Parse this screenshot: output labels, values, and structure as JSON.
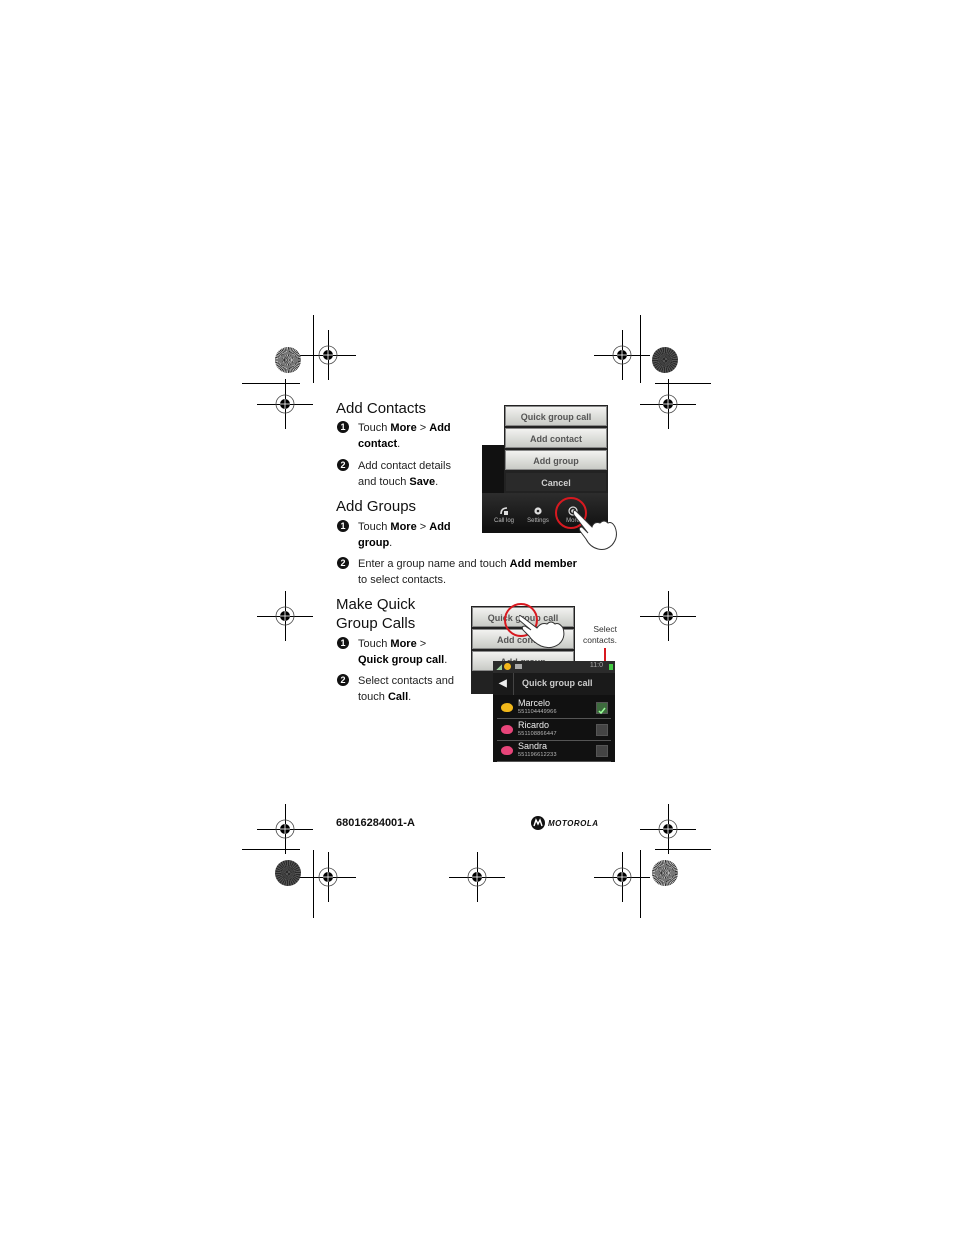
{
  "sections": [
    {
      "title": "Add Contacts",
      "steps": [
        {
          "num": "1",
          "parts": [
            {
              "t": "Touch "
            },
            {
              "t": "More",
              "b": true
            },
            {
              "t": " > "
            },
            {
              "t": "Add contact",
              "b": true
            },
            {
              "t": "."
            }
          ]
        },
        {
          "num": "2",
          "parts": [
            {
              "t": "Add contact details and touch "
            },
            {
              "t": "Save",
              "b": true
            },
            {
              "t": "."
            }
          ]
        }
      ]
    },
    {
      "title": "Add Groups",
      "steps": [
        {
          "num": "1",
          "parts": [
            {
              "t": "Touch "
            },
            {
              "t": "More",
              "b": true
            },
            {
              "t": " > "
            },
            {
              "t": "Add group",
              "b": true
            },
            {
              "t": "."
            }
          ]
        },
        {
          "num": "2",
          "parts": [
            {
              "t": "Enter a group name and touch "
            },
            {
              "t": "Add member",
              "b": true
            },
            {
              "t": " to select contacts."
            }
          ]
        }
      ]
    },
    {
      "title": "Make Quick Group Calls",
      "steps": [
        {
          "num": "1",
          "parts": [
            {
              "t": "Touch "
            },
            {
              "t": "More",
              "b": true
            },
            {
              "t": " > "
            },
            {
              "t": "Quick group call",
              "b": true
            },
            {
              "t": "."
            }
          ]
        },
        {
          "num": "2",
          "parts": [
            {
              "t": "Select contacts and touch "
            },
            {
              "t": "Call",
              "b": true
            },
            {
              "t": "."
            }
          ]
        }
      ]
    }
  ],
  "screen1": {
    "menu": [
      "Quick group call",
      "Add contact",
      "Add group",
      "Cancel"
    ],
    "dock": [
      {
        "label": "Call log",
        "icon": "call-log-icon"
      },
      {
        "label": "Settings",
        "icon": "settings-gear-icon"
      },
      {
        "label": "More",
        "icon": "more-icon"
      }
    ]
  },
  "screen2": {
    "menu": [
      "Quick group call",
      "Add contact",
      "Add group"
    ],
    "callout": "Select contacts.",
    "status_time": "11:0",
    "header_title": "Quick group call",
    "contacts": [
      {
        "name": "Marcelo",
        "number": "551104449966",
        "checked": true,
        "color": "#f2b81a"
      },
      {
        "name": "Ricardo",
        "number": "551108866447",
        "checked": false,
        "color": "#e8457a"
      },
      {
        "name": "Sandra",
        "number": "551196612233",
        "checked": false,
        "color": "#e8457a"
      }
    ]
  },
  "footer": {
    "part_number": "68016284001-A",
    "brand": "MOTOROLA"
  },
  "colors": {
    "accent_red": "#d71920"
  }
}
